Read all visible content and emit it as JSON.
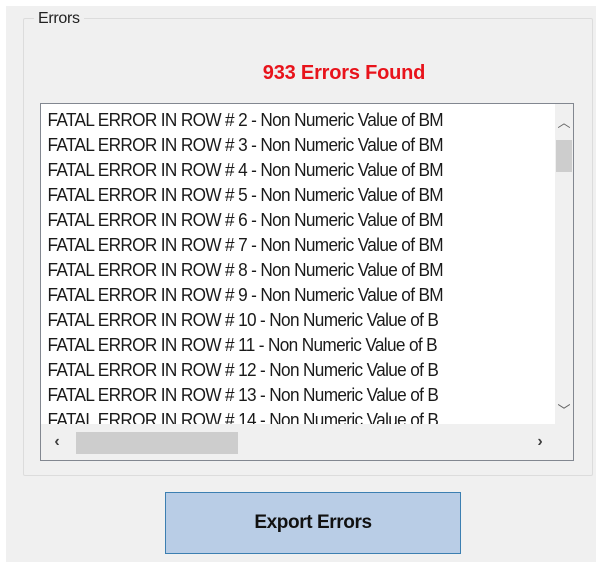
{
  "group": {
    "title": "Errors"
  },
  "summary": {
    "error_count_text": "933 Errors Found",
    "color": "#e8131b"
  },
  "error_list": {
    "items": [
      "FATAL ERROR IN ROW # 2 - Non Numeric Value of BM",
      "FATAL ERROR IN ROW # 3 - Non Numeric Value of BM",
      "FATAL ERROR IN ROW # 4 - Non Numeric Value of BM",
      "FATAL ERROR IN ROW # 5 - Non Numeric Value of BM",
      "FATAL ERROR IN ROW # 6 - Non Numeric Value of BM",
      "FATAL ERROR IN ROW # 7 - Non Numeric Value of BM",
      "FATAL ERROR IN ROW # 8 - Non Numeric Value of BM",
      "FATAL ERROR IN ROW # 9 - Non Numeric Value of BM",
      "FATAL ERROR IN ROW # 10 - Non Numeric Value of B",
      "FATAL ERROR IN ROW # 11 - Non Numeric Value of B",
      "FATAL ERROR IN ROW # 12 - Non Numeric Value of B",
      "FATAL ERROR IN ROW # 13 - Non Numeric Value of B",
      "FATAL ERROR IN ROW # 14 - Non Numeric Value of B"
    ],
    "scroll_icons": {
      "up": "chevron-up-icon",
      "down": "chevron-down-icon",
      "left": "chevron-left-icon",
      "right": "chevron-right-icon"
    }
  },
  "actions": {
    "export_label": "Export Errors",
    "button_color": "#b9cde6"
  }
}
